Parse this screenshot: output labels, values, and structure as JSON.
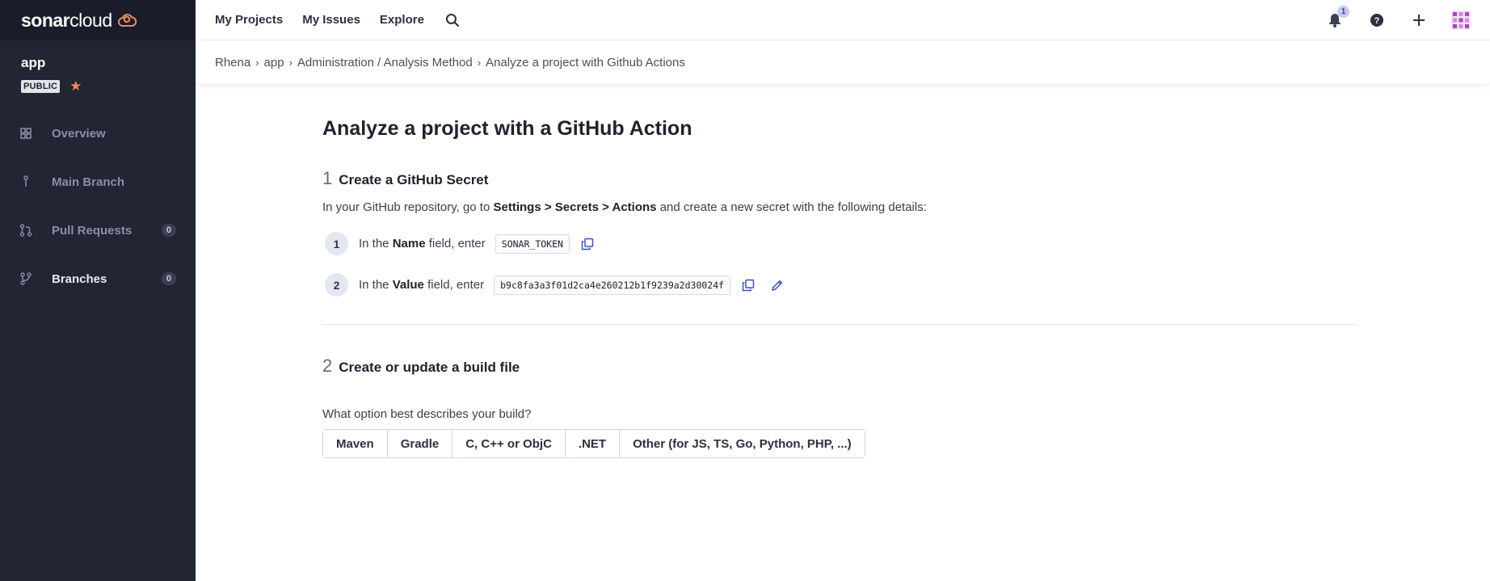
{
  "brand": {
    "name_bold": "sonar",
    "name_regular": "cloud"
  },
  "project": {
    "name": "app",
    "visibility": "PUBLIC"
  },
  "sidebar": {
    "items": [
      {
        "label": "Overview",
        "icon": "overview-icon"
      },
      {
        "label": "Main Branch",
        "icon": "branch-icon"
      },
      {
        "label": "Pull Requests",
        "icon": "pull-request-icon",
        "count": "0"
      },
      {
        "label": "Branches",
        "icon": "branches-icon",
        "count": "0"
      }
    ]
  },
  "topnav": {
    "my_projects": "My Projects",
    "my_issues": "My Issues",
    "explore": "Explore"
  },
  "notifications": {
    "count": "1"
  },
  "breadcrumb": [
    "Rhena",
    "app",
    "Administration / Analysis Method",
    "Analyze a project with Github Actions"
  ],
  "page": {
    "title": "Analyze a project with a GitHub Action",
    "step1": {
      "number": "1",
      "title": "Create a GitHub Secret",
      "desc_pre": "In your GitHub repository, go to ",
      "desc_bold": "Settings > Secrets > Actions",
      "desc_post": " and create a new secret with the following details:",
      "rows": [
        {
          "num": "1",
          "pre": "In the ",
          "bold": "Name",
          "post": " field, enter",
          "value": "SONAR_TOKEN"
        },
        {
          "num": "2",
          "pre": "In the ",
          "bold": "Value",
          "post": " field, enter",
          "value": "b9c8fa3a3f01d2ca4e260212b1f9239a2d30024f"
        }
      ]
    },
    "step2": {
      "number": "2",
      "title": "Create or update a build file",
      "question": "What option best describes your build?",
      "options": [
        "Maven",
        "Gradle",
        "C, C++ or ObjC",
        ".NET",
        "Other (for JS, TS, Go, Python, PHP, ...)"
      ]
    }
  },
  "colors": {
    "sidebar_bg": "#212534",
    "accent_orange": "#f08a5d"
  }
}
